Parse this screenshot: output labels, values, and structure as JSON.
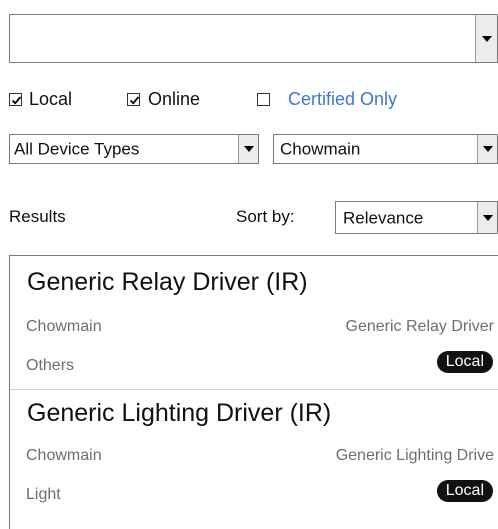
{
  "search": {
    "value": ""
  },
  "filters": {
    "local": {
      "label": "Local",
      "checked": true
    },
    "online": {
      "label": "Online",
      "checked": true
    },
    "certified": {
      "label": "Certified Only",
      "checked": false,
      "color": "#3a78d6"
    }
  },
  "device_type": {
    "value": "All Device Types"
  },
  "manufacturer": {
    "value": "Chowmain"
  },
  "results_label": "Results",
  "sort": {
    "label": "Sort by:",
    "value": "Relevance"
  },
  "results": [
    {
      "title": "Generic Relay Driver (IR)",
      "manufacturer": "Chowmain",
      "model": "Generic Relay Driver",
      "category": "Others",
      "badge": "Local"
    },
    {
      "title": "Generic Lighting Driver (IR)",
      "manufacturer": "Chowmain",
      "model": "Generic Lighting Drive",
      "category": "Light",
      "badge": "Local"
    }
  ],
  "icons": {
    "dropdown": "chevron-down-icon",
    "checkbox": "checkmark-icon"
  }
}
